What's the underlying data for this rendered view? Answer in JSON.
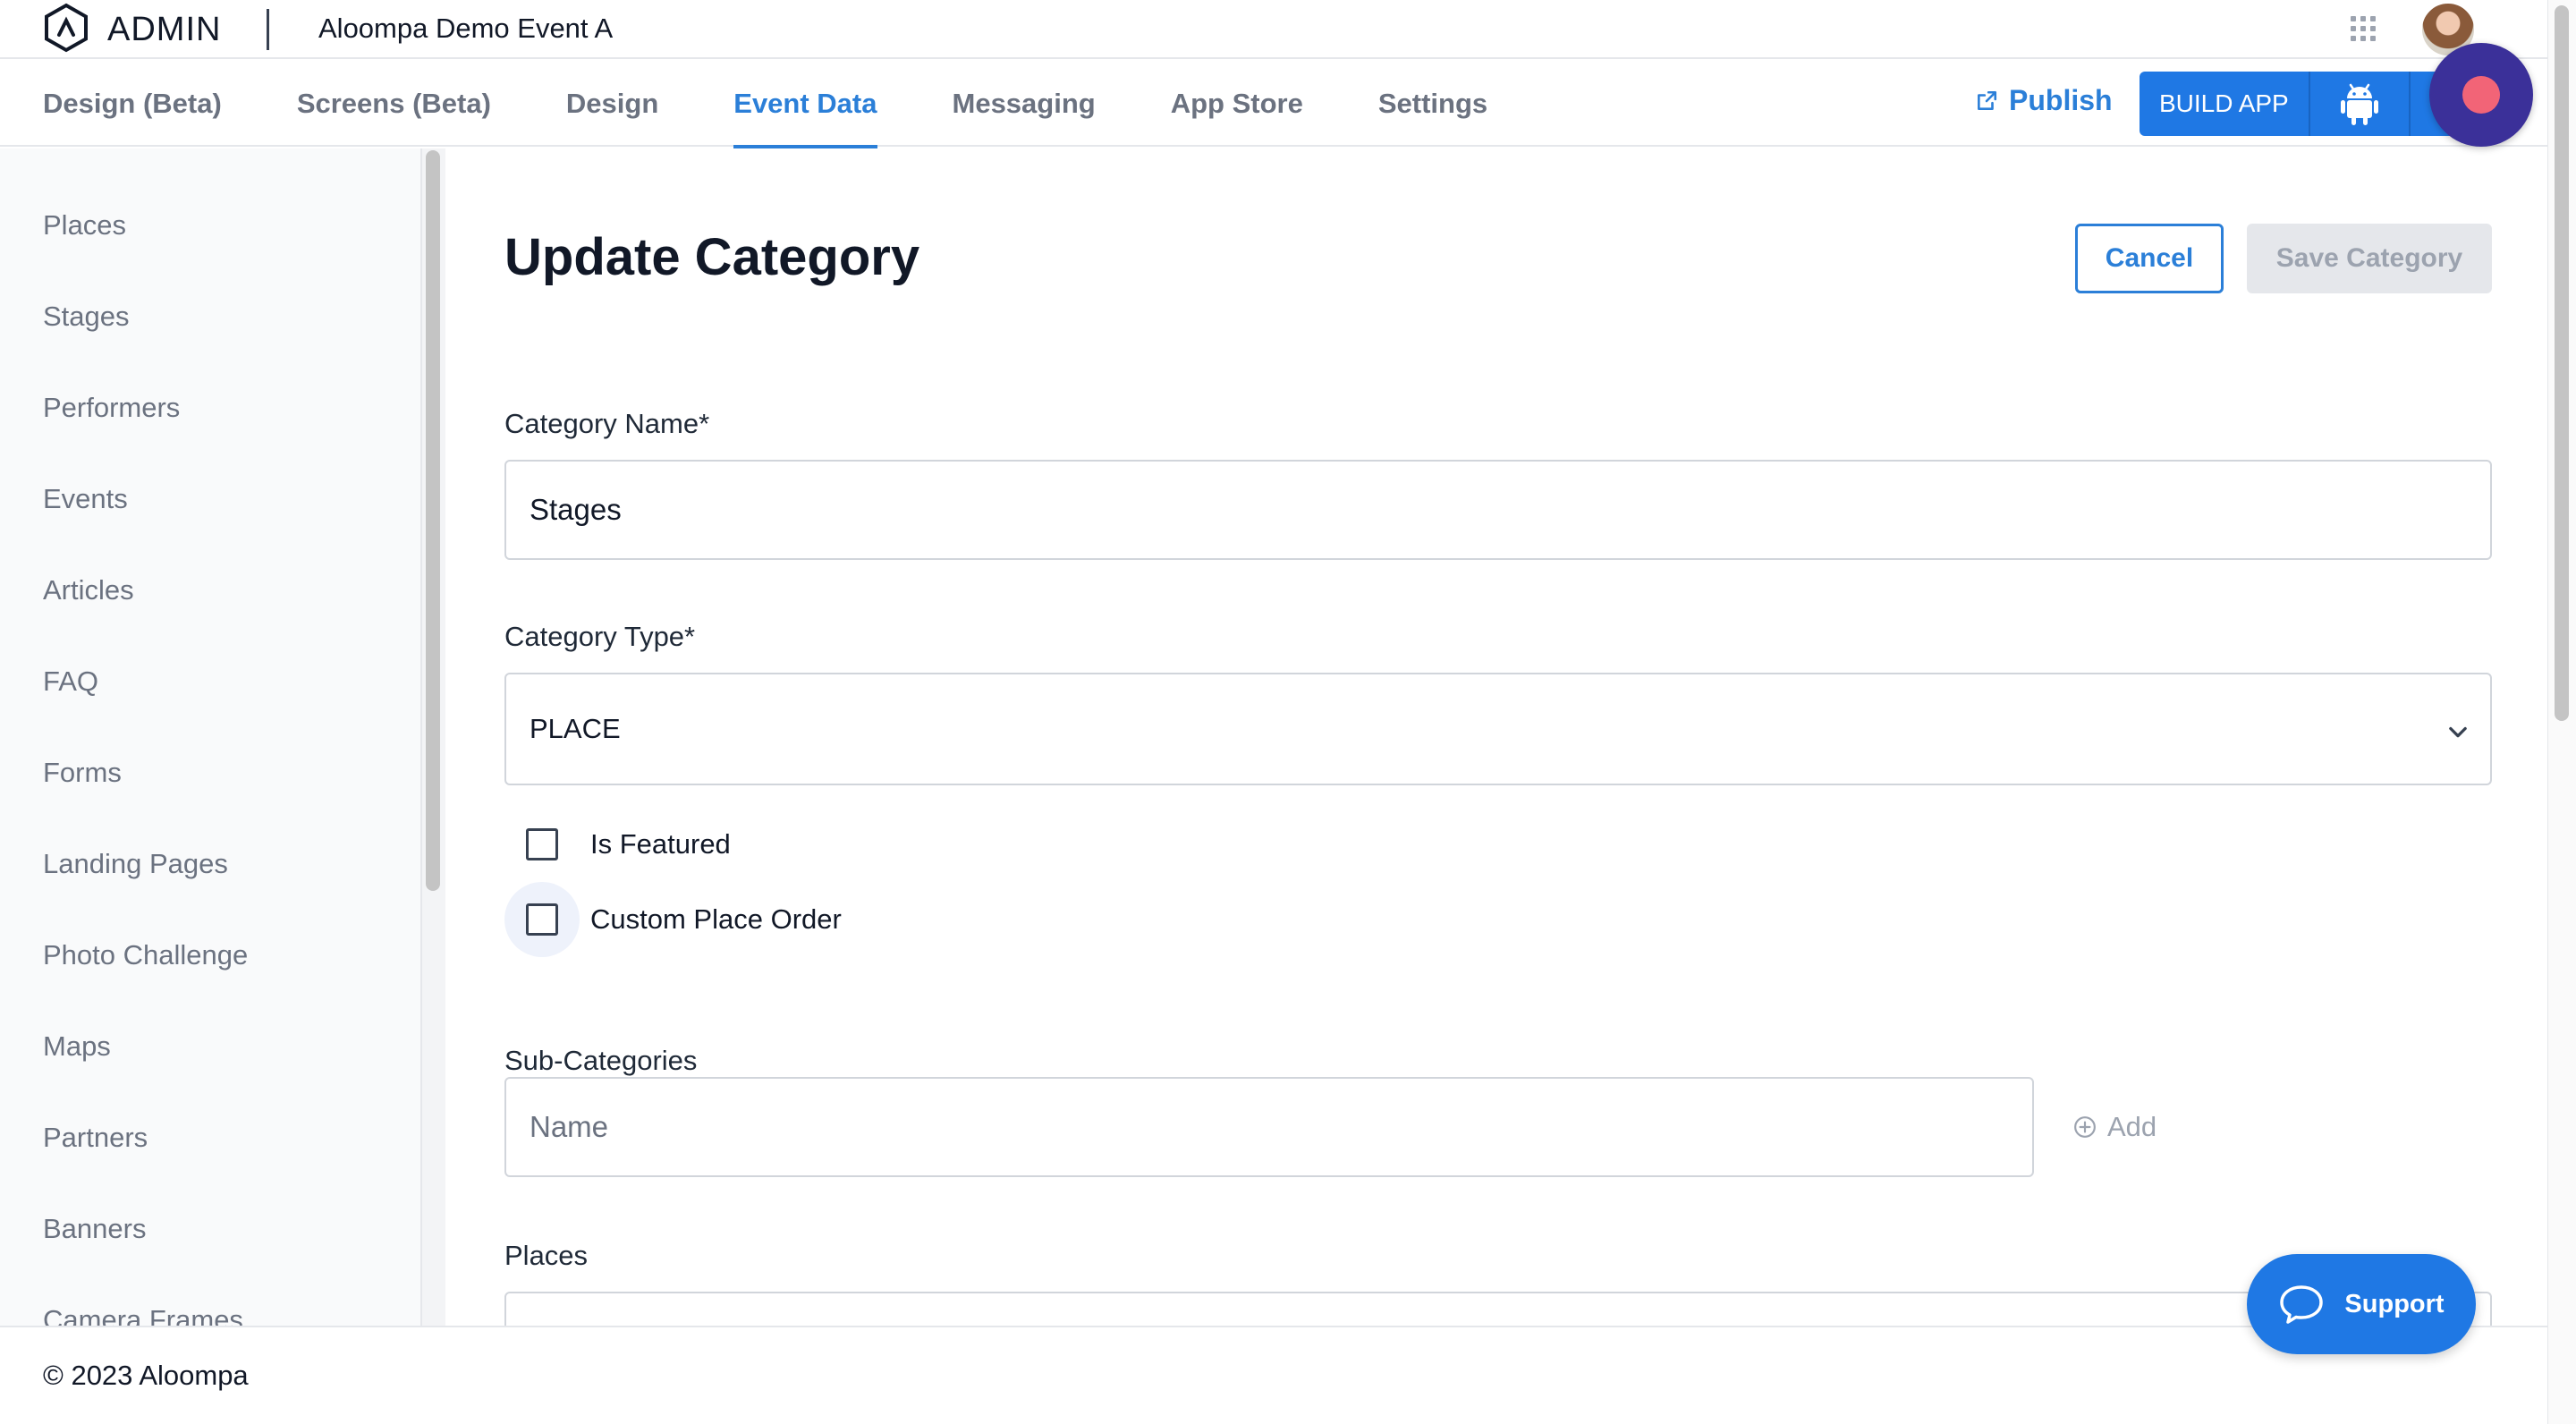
{
  "header": {
    "admin_label": "ADMIN",
    "event_title": "Aloompa Demo Event A"
  },
  "nav": {
    "tabs": [
      {
        "label": "Design (Beta)",
        "active": false
      },
      {
        "label": "Screens (Beta)",
        "active": false
      },
      {
        "label": "Design",
        "active": false
      },
      {
        "label": "Event Data",
        "active": true
      },
      {
        "label": "Messaging",
        "active": false
      },
      {
        "label": "App Store",
        "active": false
      },
      {
        "label": "Settings",
        "active": false
      }
    ],
    "publish_label": "Publish",
    "build_app_label": "BUILD APP",
    "icons": {
      "publish": "external-link-icon",
      "android": "android-icon",
      "apps": "grid-icon",
      "record": "record-icon"
    }
  },
  "sidebar": {
    "items": [
      {
        "label": "Places"
      },
      {
        "label": "Stages"
      },
      {
        "label": "Performers"
      },
      {
        "label": "Events"
      },
      {
        "label": "Articles"
      },
      {
        "label": "FAQ"
      },
      {
        "label": "Forms"
      },
      {
        "label": "Landing Pages"
      },
      {
        "label": "Photo Challenge"
      },
      {
        "label": "Maps"
      },
      {
        "label": "Partners"
      },
      {
        "label": "Banners"
      },
      {
        "label": "Camera Frames"
      }
    ]
  },
  "form": {
    "title": "Update Category",
    "cancel_label": "Cancel",
    "save_label": "Save Category",
    "category_name_label": "Category Name*",
    "category_name_value": "Stages",
    "category_type_label": "Category Type*",
    "category_type_value": "PLACE",
    "is_featured_label": "Is Featured",
    "is_featured_checked": false,
    "custom_place_order_label": "Custom Place Order",
    "custom_place_order_checked": false,
    "subcategories_label": "Sub-Categories",
    "subcategory_placeholder": "Name",
    "add_label": "Add",
    "places_label": "Places"
  },
  "support": {
    "label": "Support"
  },
  "footer": {
    "copyright": "© 2023 Aloompa"
  },
  "colors": {
    "accent": "#2b7fd8",
    "button_blue": "#1f78e4",
    "record_bg": "#3b3099",
    "record_dot": "#f26477"
  }
}
